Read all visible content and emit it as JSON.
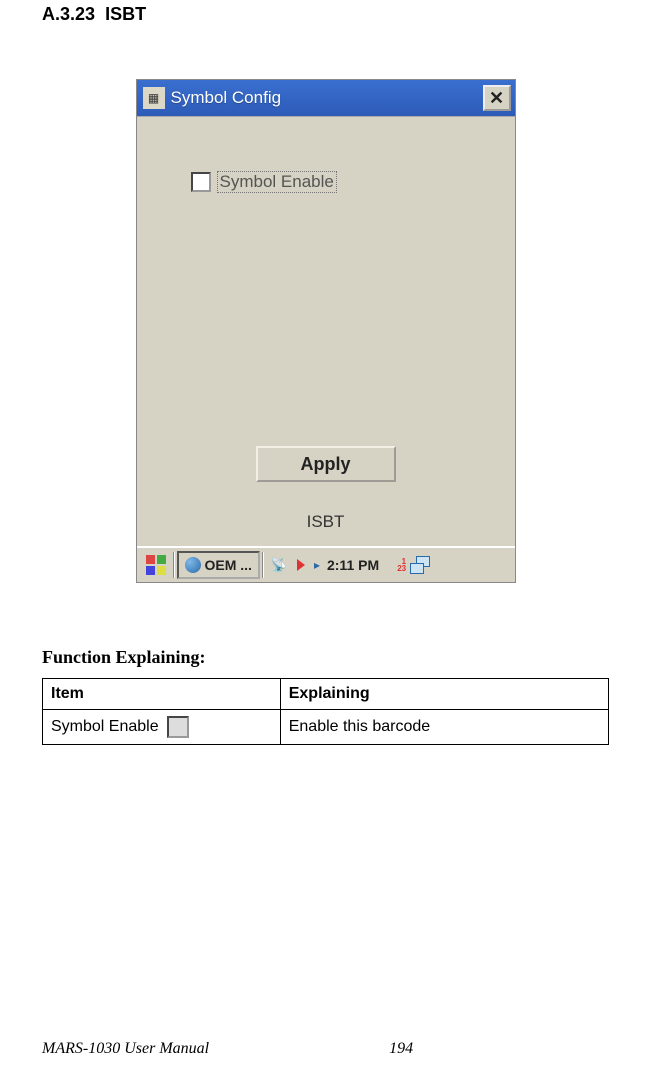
{
  "section": {
    "number": "A.3.23",
    "title": "ISBT"
  },
  "window": {
    "title": "Symbol Config",
    "checkbox_label": "Symbol Enable",
    "apply_label": "Apply",
    "tab_label": "ISBT"
  },
  "taskbar": {
    "app_label": "OEM ...",
    "time": "2:11 PM",
    "keyboard_badge_top": "1",
    "keyboard_badge_bottom": "23"
  },
  "function_section": {
    "heading": "Function Explaining:",
    "headers": {
      "item": "Item",
      "explaining": "Explaining"
    },
    "rows": [
      {
        "item": "Symbol Enable",
        "explaining": "Enable this barcode"
      }
    ]
  },
  "footer": {
    "manual": "MARS-1030 User Manual",
    "page": "194"
  }
}
